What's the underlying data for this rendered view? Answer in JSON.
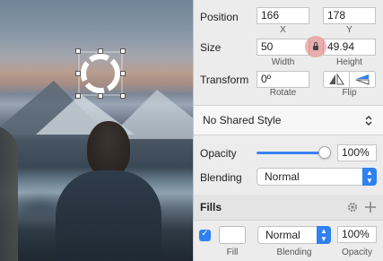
{
  "inspector": {
    "position": {
      "label": "Position",
      "x": {
        "value": "166",
        "caption": "X"
      },
      "y": {
        "value": "178",
        "caption": "Y"
      }
    },
    "size": {
      "label": "Size",
      "width": {
        "value": "50",
        "caption": "Width"
      },
      "height": {
        "value": "49.94",
        "caption": "Height"
      },
      "lock_icon": "lock-icon"
    },
    "transform": {
      "label": "Transform",
      "rotate": {
        "value": "0º",
        "caption": "Rotate"
      },
      "flip": {
        "caption": "Flip",
        "horizontal_icon": "flip-horizontal-icon",
        "vertical_icon": "flip-vertical-icon"
      }
    },
    "shared_style": {
      "value": "No Shared Style",
      "icon": "up-down-chevron-icon"
    },
    "opacity": {
      "label": "Opacity",
      "value": "100%",
      "slider_fraction": 1.0
    },
    "blending": {
      "label": "Blending",
      "value": "Normal"
    },
    "fills": {
      "title": "Fills",
      "settings_icon": "gear-icon",
      "add_icon": "plus-icon",
      "items": [
        {
          "enabled": true,
          "color": "#ffffff",
          "swatch_caption": "Fill",
          "blending": "Normal",
          "blending_caption": "Blending",
          "opacity": "100%",
          "opacity_caption": "Opacity"
        }
      ]
    },
    "accent_color": "#2f80f1"
  },
  "canvas": {
    "selected_shape": "dashed-circle-icon"
  }
}
